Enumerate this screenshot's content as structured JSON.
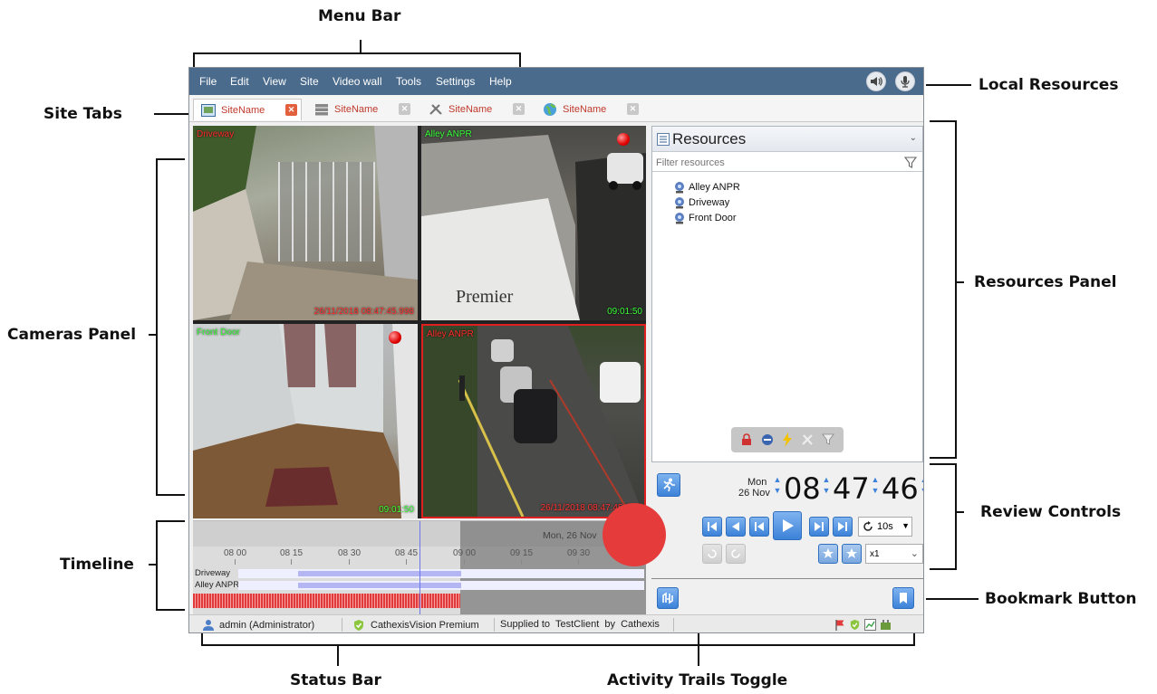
{
  "annotations": {
    "menu_bar": "Menu Bar",
    "local_resources": "Local Resources",
    "site_tabs": "Site Tabs",
    "resources_panel": "Resources Panel",
    "cameras_panel": "Cameras Panel",
    "review_controls": "Review Controls",
    "timeline": "Timeline",
    "bookmark_button": "Bookmark Button",
    "status_bar": "Status Bar",
    "activity_trails_toggle": "Activity Trails Toggle"
  },
  "menu": {
    "items": [
      "File",
      "Edit",
      "View",
      "Site",
      "Video wall",
      "Tools",
      "Settings",
      "Help"
    ]
  },
  "tabs": [
    {
      "label": "SiteName",
      "icon": "image-tab-icon",
      "active": true
    },
    {
      "label": "SiteName",
      "icon": "server-tab-icon",
      "active": false
    },
    {
      "label": "SiteName",
      "icon": "tools-tab-icon",
      "active": false
    },
    {
      "label": "SiteName",
      "icon": "globe-tab-icon",
      "active": false
    }
  ],
  "cameras": [
    {
      "name": "Driveway",
      "name_color": "#ff2a2a",
      "timestamp": "26/11/2018 08:47:45.998",
      "ts_color": "#ff3030",
      "recording": false
    },
    {
      "name": "Alley ANPR",
      "name_color": "#39ff39",
      "timestamp": "09:01:50",
      "ts_color": "#39ff39",
      "recording": true
    },
    {
      "name": "Front Door",
      "name_color": "#39ff39",
      "timestamp": "09:01:50",
      "ts_color": "#39ff39",
      "recording": true
    },
    {
      "name": "Alley ANPR",
      "name_color": "#ff2a2a",
      "timestamp": "26/11/2018 08:47:45.995",
      "ts_color": "#ff3030",
      "recording": false
    }
  ],
  "sign_text": "Premier",
  "timeline": {
    "date_label": "Mon, 26 Nov",
    "ticks": [
      "08 00",
      "08 15",
      "08 30",
      "08 45",
      "09 00",
      "09 15",
      "09 30"
    ],
    "tracks": [
      "Driveway",
      "Alley ANPR"
    ]
  },
  "status": {
    "user": "admin (Administrator)",
    "license": "CathexisVision Premium",
    "supplied": "Supplied to  TestClient  by  Cathexis"
  },
  "resources": {
    "title": "Resources",
    "filter_placeholder": "Filter resources",
    "items": [
      "Alley ANPR",
      "Driveway",
      "Front Door"
    ]
  },
  "review": {
    "day": "Mon",
    "date": "26 Nov",
    "hours": "08",
    "minutes": "47",
    "seconds": "46",
    "loop": "10s",
    "speed": "x1"
  },
  "colors": {
    "menubar": "#4a6b8c",
    "accent_blue": "#3c82d8",
    "tab_text": "#c0392b"
  }
}
